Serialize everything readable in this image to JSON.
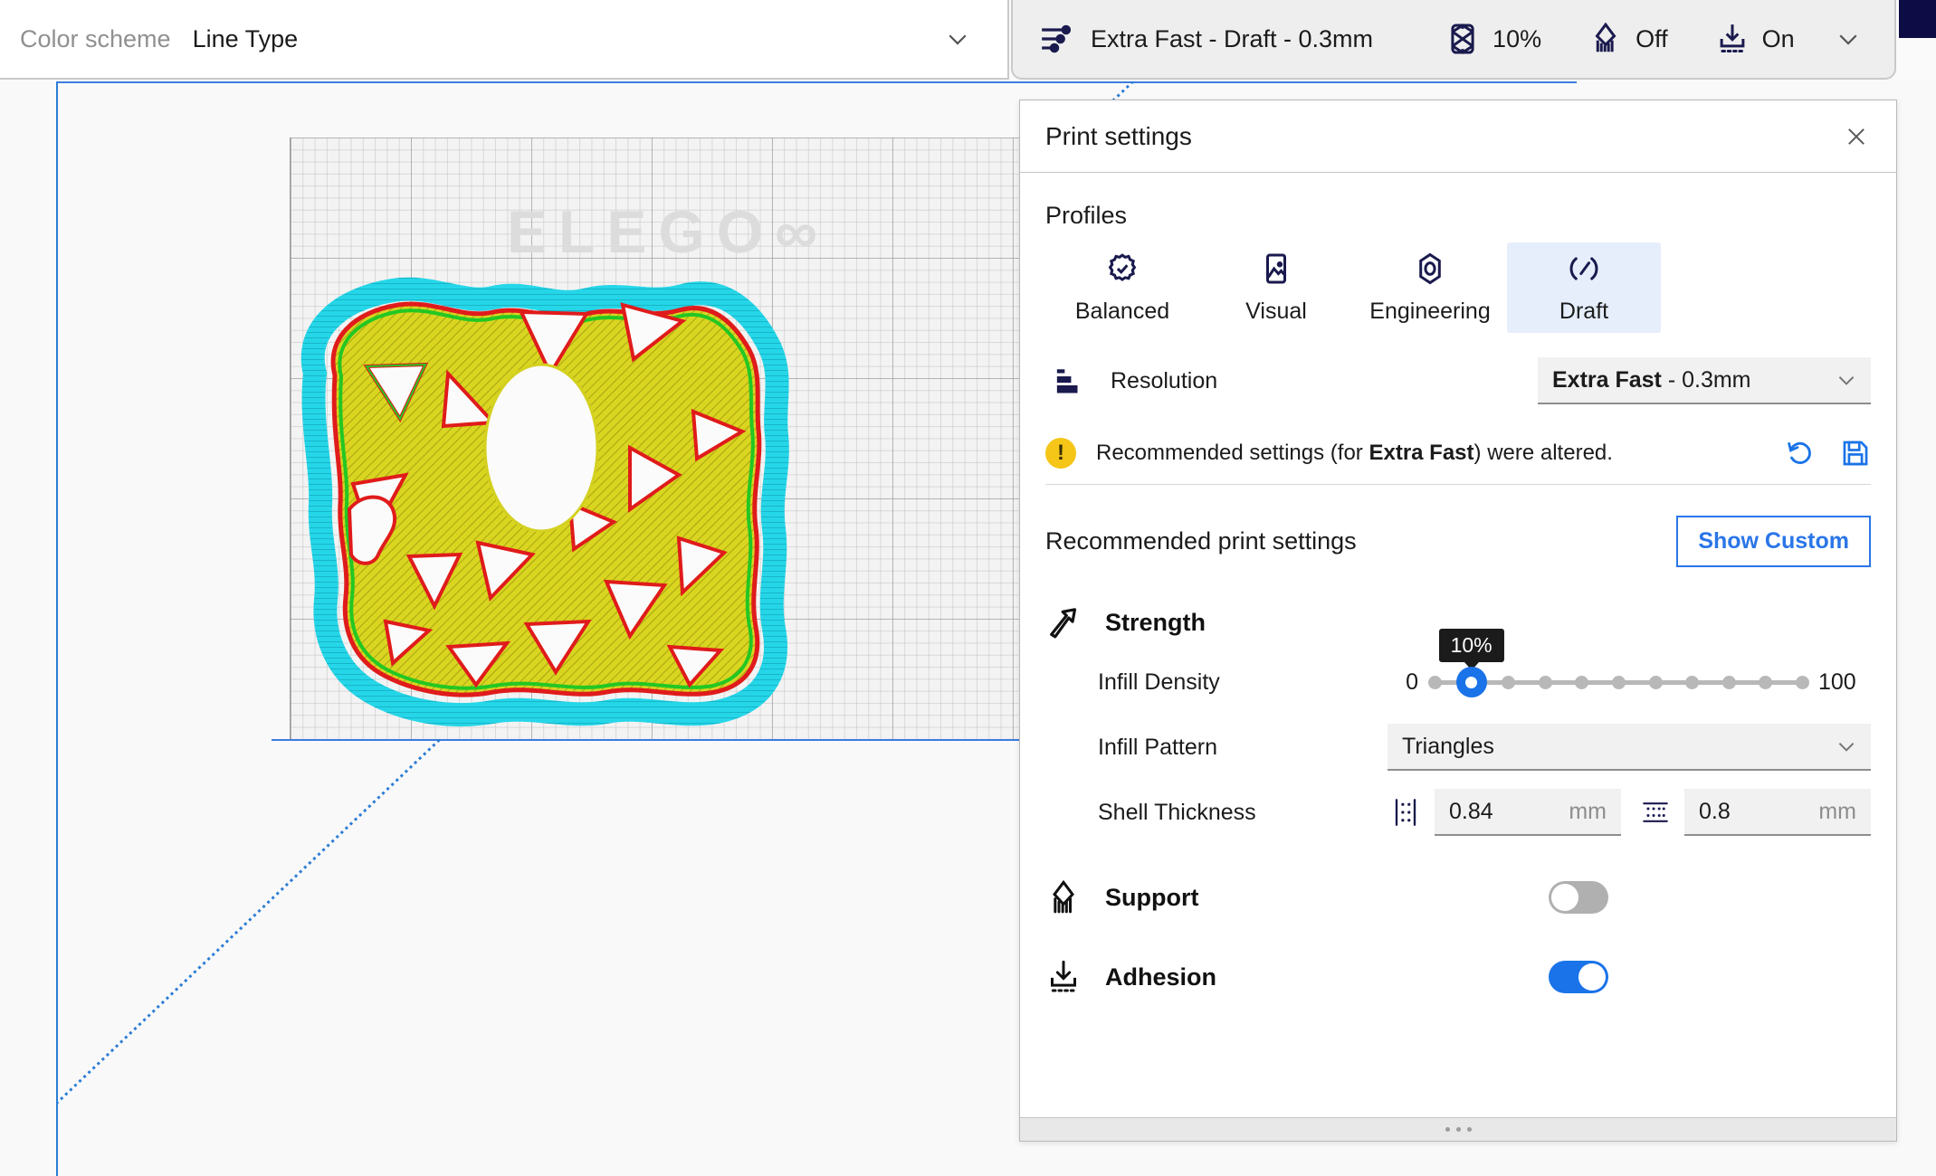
{
  "toolbar_left": {
    "color_scheme_label": "Color scheme",
    "color_scheme_value": "Line Type",
    "chevron_icon": "chevron-down-icon"
  },
  "toolbar_right": {
    "settings_icon": "sliders-icon",
    "profile_summary": "Extra Fast - Draft - 0.3mm",
    "infill_icon": "infill-icon",
    "infill_value": "10%",
    "support_icon": "support-icon",
    "support_value": "Off",
    "adhesion_icon": "adhesion-icon",
    "adhesion_value": "On",
    "expand_icon": "chevron-down-icon"
  },
  "viewport": {
    "brand": "ELEGO",
    "brand_suffix": "∞",
    "axes": {
      "x_color": "#d92b2b",
      "y_color": "#2b7cd3",
      "z_color": "#22a04a"
    },
    "model_colors": {
      "infill": "#d9d520",
      "skirt_brim": "#25d6e8",
      "inner_wall": "#23c723",
      "outer_wall": "#e01b1b"
    }
  },
  "panel": {
    "title": "Print settings",
    "close_icon": "close-icon",
    "profiles_label": "Profiles",
    "profiles": [
      {
        "label": "Balanced",
        "icon": "gear-check-icon",
        "active": false
      },
      {
        "label": "Visual",
        "icon": "image-icon",
        "active": false
      },
      {
        "label": "Engineering",
        "icon": "nut-icon",
        "active": false
      },
      {
        "label": "Draft",
        "icon": "speedometer-icon",
        "active": true
      }
    ],
    "resolution": {
      "icon": "layers-icon",
      "label": "Resolution",
      "value_bold": "Extra Fast",
      "value_rest": " - 0.3mm",
      "chevron_icon": "chevron-down-icon"
    },
    "warning": {
      "icon": "exclamation-icon",
      "mark": "!",
      "text_before": "Recommended settings (for ",
      "text_bold": "Extra Fast",
      "text_after": ") were altered.",
      "reset_icon": "undo-icon",
      "save_icon": "save-icon"
    },
    "recommended": {
      "title": "Recommended print settings",
      "show_custom_label": "Show Custom"
    },
    "strength": {
      "icon": "strength-icon",
      "title": "Strength",
      "infill_density": {
        "label": "Infill Density",
        "min": "0",
        "max": "100",
        "value": 10,
        "tooltip": "10%",
        "ticks": [
          0,
          10,
          20,
          30,
          40,
          50,
          60,
          70,
          80,
          90,
          100
        ]
      },
      "infill_pattern": {
        "label": "Infill Pattern",
        "value": "Triangles",
        "chevron_icon": "chevron-down-icon"
      },
      "shell_thickness": {
        "label": "Shell Thickness",
        "wall": {
          "icon": "wall-thickness-icon",
          "value": "0.84",
          "unit": "mm"
        },
        "top_bottom": {
          "icon": "top-bottom-thickness-icon",
          "value": "0.8",
          "unit": "mm"
        }
      }
    },
    "support": {
      "icon": "support-icon",
      "title": "Support",
      "enabled": false
    },
    "adhesion": {
      "icon": "adhesion-icon",
      "title": "Adhesion",
      "enabled": true
    },
    "footer_grip_icon": "resize-grip-icon"
  },
  "accent": {
    "blue": "#1a73e8",
    "link_blue": "#2a76e8",
    "navy": "#1a1a4e",
    "warning_yellow": "#f5c518"
  }
}
